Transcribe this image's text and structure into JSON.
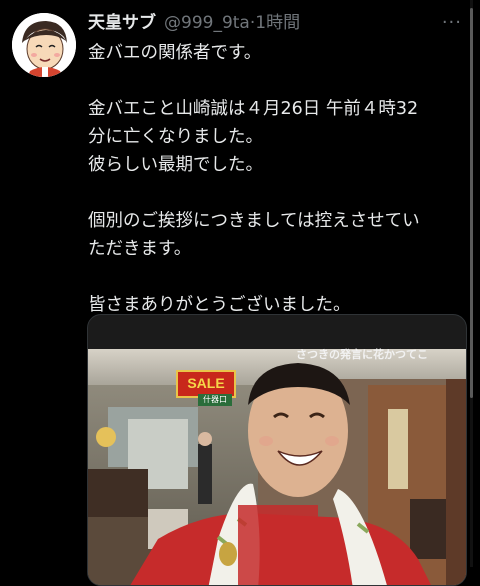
{
  "tweet": {
    "display_name": "天皇サブ",
    "handle": "@999_9ta",
    "separator": "·",
    "time": "1時間",
    "more_icon": "more-horizontal-icon",
    "text_lines": [
      "金バエの関係者です。",
      "",
      "金バエこと山崎誠は４月26日 午前４時32",
      "分に亡くなりました。",
      "彼らしい最期でした。",
      "",
      "個別のご挨拶につきましては控えさせてい",
      "ただきます。",
      "",
      "皆さまありがとうございました。"
    ]
  },
  "media": {
    "caption": "さつきの発言に花かつてこ",
    "sale_sign": "SALE",
    "sub_sign": "什器口"
  },
  "colors": {
    "background": "#000000",
    "text": "#e7e9ea",
    "secondary": "#71767b",
    "border": "#2f3336"
  }
}
